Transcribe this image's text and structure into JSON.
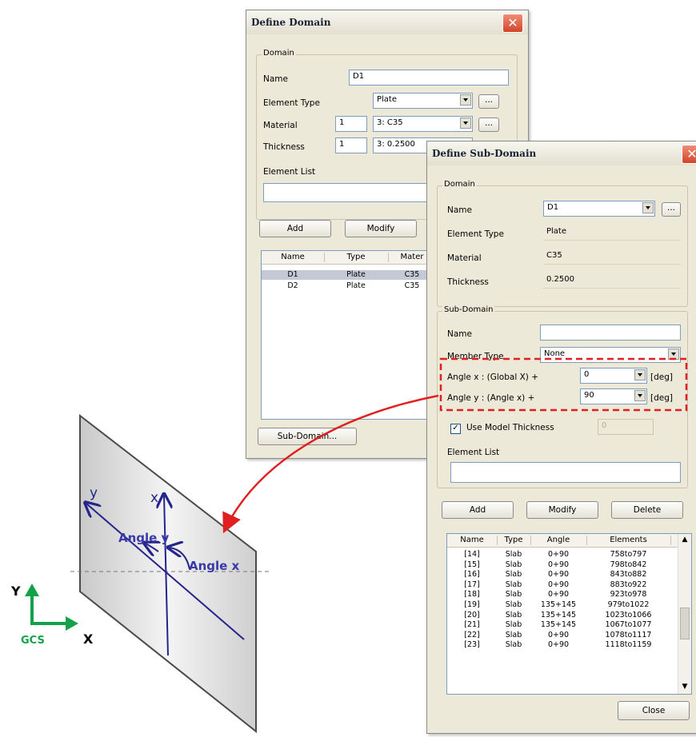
{
  "define_domain": {
    "title": "Define Domain",
    "close_glyph": "✕",
    "domain_group": "Domain",
    "name_label": "Name",
    "name_value": "D1",
    "element_type_label": "Element Type",
    "element_type_value": "Plate",
    "material_label": "Material",
    "material_no": "1",
    "material_value": "3: C35",
    "thickness_label": "Thickness",
    "thickness_no": "1",
    "thickness_value": "3: 0.2500",
    "element_list_label": "Element List",
    "ellipsis": "...",
    "add_label": "Add",
    "modify_label": "Modify",
    "columns": [
      "Name",
      "Type",
      "Mater"
    ],
    "rows": [
      {
        "name": "D1",
        "type": "Plate",
        "mat": "C35"
      },
      {
        "name": "D2",
        "type": "Plate",
        "mat": "C35"
      }
    ],
    "subdomain_button": "Sub-Domain..."
  },
  "define_subdomain": {
    "title": "Define Sub-Domain",
    "close_glyph": "✕",
    "domain_group": "Domain",
    "name_label": "Name",
    "name_value": "D1",
    "element_type_label": "Element Type",
    "element_type_value": "Plate",
    "material_label": "Material",
    "material_value": "C35",
    "thickness_label": "Thickness",
    "thickness_value": "0.2500",
    "subdomain_group": "Sub-Domain",
    "sub_name_label": "Name",
    "sub_name_value": "",
    "member_type_label": "Member Type",
    "member_type_value": "None",
    "angle_x_label": "Angle x : (Global X) +",
    "angle_x_value": "0",
    "angle_y_label": "Angle y : (Angle x) +",
    "angle_y_value": "90",
    "deg_unit": "[deg]",
    "use_model_thickness_label": "Use Model Thickness",
    "use_model_thickness_checked": true,
    "thickness_field_value": "0",
    "element_list_label": "Element List",
    "add_label": "Add",
    "modify_label": "Modify",
    "delete_label": "Delete",
    "columns": [
      "Name",
      "Type",
      "Angle",
      "Elements"
    ],
    "rows": [
      {
        "name": "[14]",
        "type": "Slab",
        "angle": "0+90",
        "elements": "758to797"
      },
      {
        "name": "[15]",
        "type": "Slab",
        "angle": "0+90",
        "elements": "798to842"
      },
      {
        "name": "[16]",
        "type": "Slab",
        "angle": "0+90",
        "elements": "843to882"
      },
      {
        "name": "[17]",
        "type": "Slab",
        "angle": "0+90",
        "elements": "883to922"
      },
      {
        "name": "[18]",
        "type": "Slab",
        "angle": "0+90",
        "elements": "923to978"
      },
      {
        "name": "[19]",
        "type": "Slab",
        "angle": "135+145",
        "elements": "979to1022"
      },
      {
        "name": "[20]",
        "type": "Slab",
        "angle": "135+145",
        "elements": "1023to1066"
      },
      {
        "name": "[21]",
        "type": "Slab",
        "angle": "135+145",
        "elements": "1067to1077"
      },
      {
        "name": "[22]",
        "type": "Slab",
        "angle": "0+90",
        "elements": "1078to1117"
      },
      {
        "name": "[23]",
        "type": "Slab",
        "angle": "0+90",
        "elements": "1118to1159"
      }
    ],
    "close_label": "Close"
  },
  "diagram": {
    "label_y": "y",
    "label_x": "x",
    "angle_y": "Angle y",
    "angle_x": "Angle x",
    "gcs_y": "Y",
    "gcs_x": "X",
    "gcs": "GCS"
  },
  "colors": {
    "highlight": "#e02020",
    "axis_blue": "#24248c",
    "gcs_green": "#13a24a",
    "dialog_bg": "#ece9d8"
  }
}
